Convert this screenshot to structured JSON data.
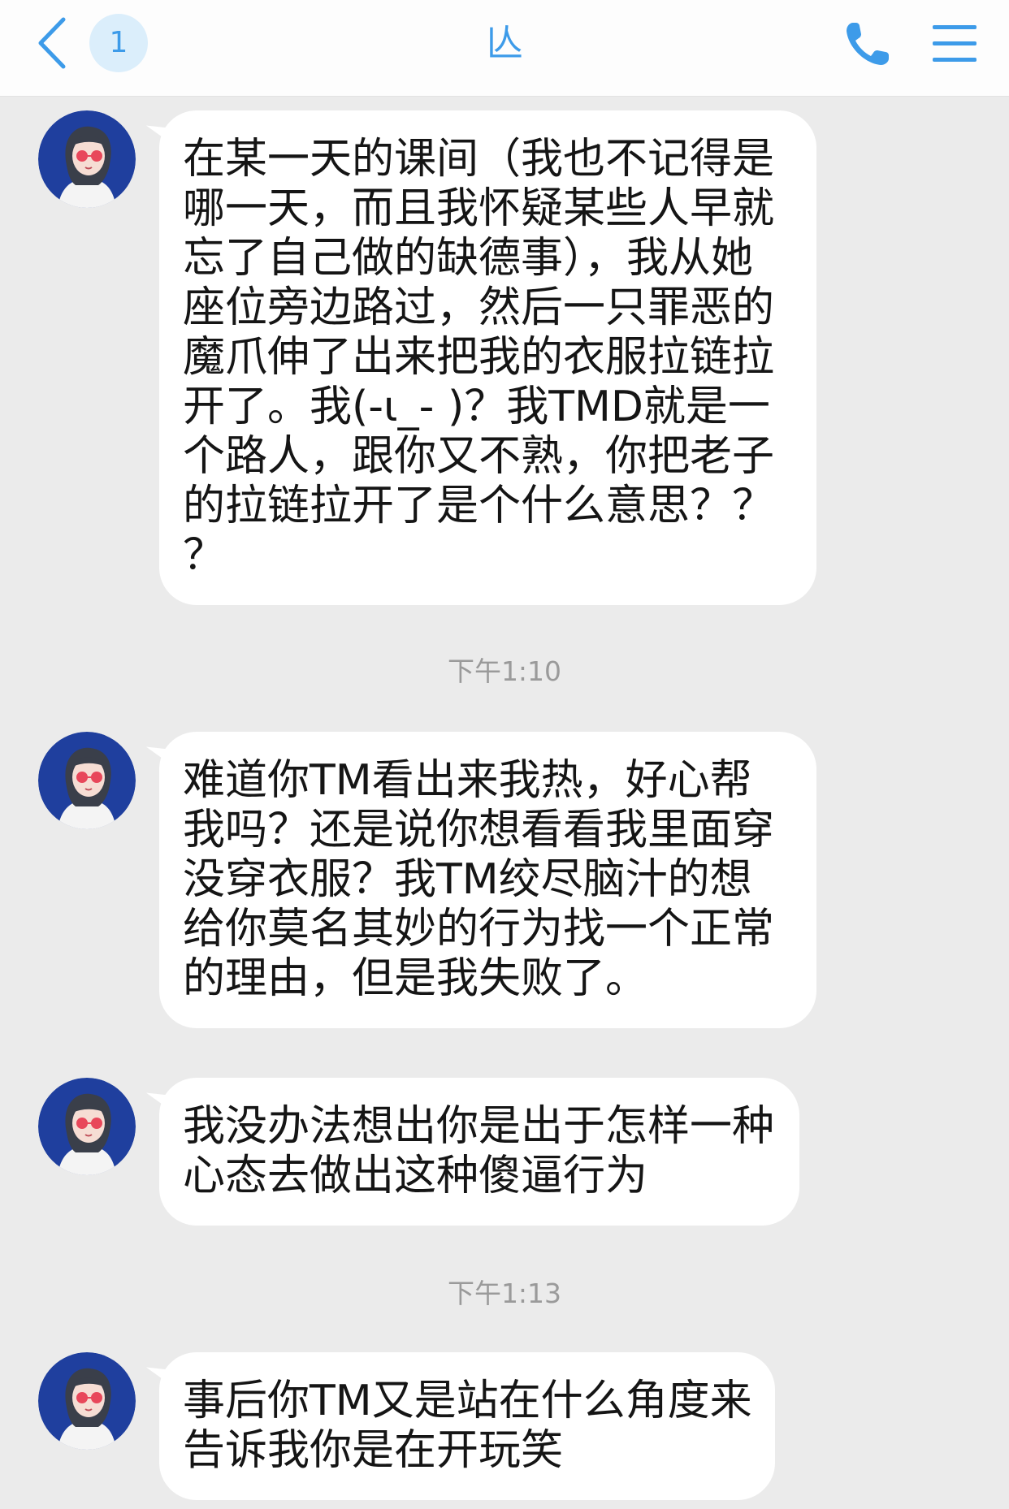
{
  "header": {
    "title": "亾",
    "unread_count": "1",
    "back_icon": "chevron-left-icon",
    "call_icon": "phone-icon",
    "menu_icon": "menu-icon"
  },
  "colors": {
    "accent": "#3d9be9",
    "badge_bg": "#dbeefb",
    "background": "#ebebeb",
    "bubble": "#ffffff",
    "timestamp": "#9a9a9a"
  },
  "messages": [
    {
      "sender_avatar": "avatar-icon",
      "lines": [
        "在某一天的课间（我也不记得是",
        "哪一天，而且我怀疑某些人早就",
        "忘了自己做的缺德事），我从她",
        "座位旁边路过，然后一只罪恶的",
        "魔爪伸了出来把我的衣服拉链拉",
        "开了。我(-ι_- )？我TMD就是一",
        "个路人，跟你又不熟，你把老子",
        "的拉链拉开了是个什么意思？？",
        "？"
      ]
    },
    {
      "sender_avatar": "avatar-icon",
      "lines": [
        "难道你TM看出来我热，好心帮",
        "我吗？还是说你想看看我里面穿",
        "没穿衣服？我TM绞尽脑汁的想",
        "给你莫名其妙的行为找一个正常",
        "的理由，但是我失败了。"
      ]
    },
    {
      "sender_avatar": "avatar-icon",
      "lines": [
        "我没办法想出你是出于怎样一种",
        "心态去做出这种傻逼行为"
      ]
    },
    {
      "sender_avatar": "avatar-icon",
      "lines": [
        "事后你TM又是站在什么角度来",
        "告诉我你是在开玩笑"
      ]
    }
  ],
  "timestamps": [
    "下午1:10",
    "下午1:13"
  ]
}
